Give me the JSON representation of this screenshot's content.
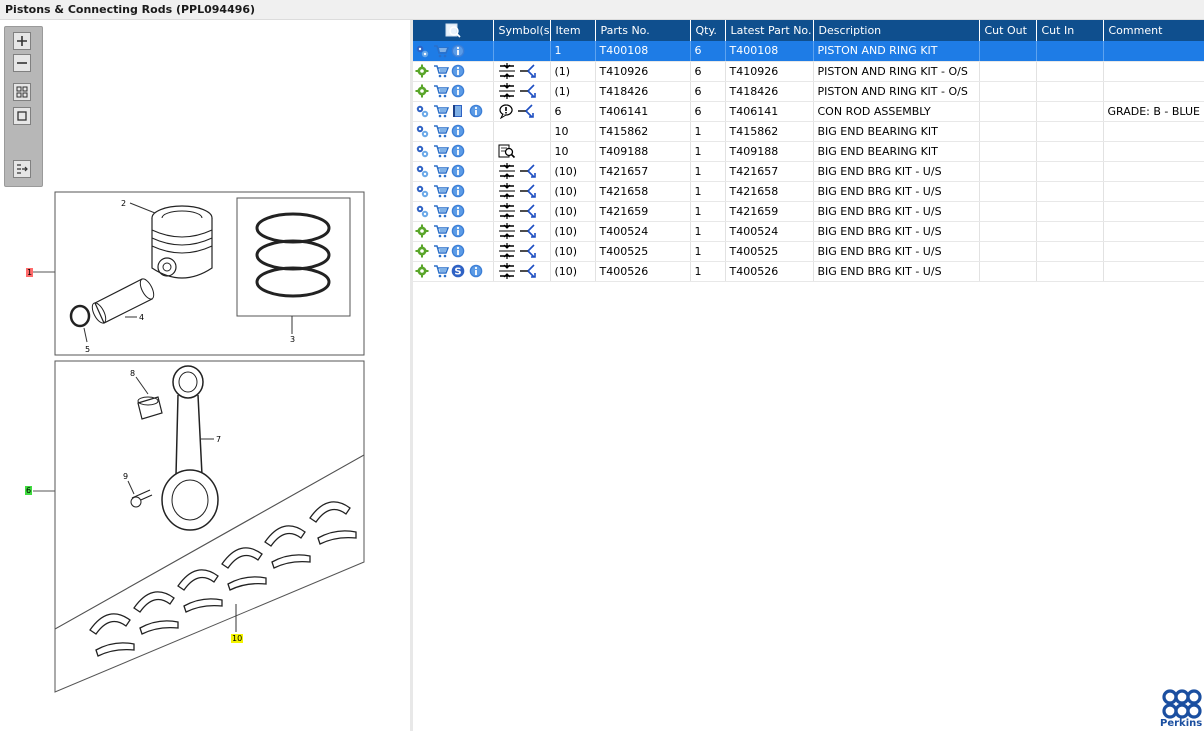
{
  "window": {
    "title": "Pistons & Connecting Rods (PPL094496)"
  },
  "diagram": {
    "callouts": [
      "2",
      "3",
      "4",
      "5",
      "7",
      "8",
      "9"
    ],
    "hotspots": [
      {
        "label": "1",
        "color": "#ff6b6b"
      },
      {
        "label": "6",
        "color": "#3fdc3f"
      },
      {
        "label": "10",
        "color": "#f5f500"
      }
    ]
  },
  "table": {
    "columns": [
      "Symbol(s)",
      "Item",
      "Parts No.",
      "Qty.",
      "Latest Part No.",
      "Description",
      "Cut Out",
      "Cut In",
      "Comment"
    ],
    "rows": [
      {
        "icons": [
          "parts-gear",
          "cart",
          "info"
        ],
        "symbols": [],
        "item": "1",
        "part": "T400108",
        "qty": "6",
        "latest": "T400108",
        "desc": "PISTON AND RING KIT",
        "cutout": "",
        "cutin": "",
        "comment": "",
        "selected": true
      },
      {
        "icons": [
          "gear",
          "cart",
          "info"
        ],
        "symbols": [
          "compress",
          "arrow"
        ],
        "item": "(1)",
        "part": "T410926",
        "qty": "6",
        "latest": "T410926",
        "desc": "PISTON AND RING KIT - O/S",
        "cutout": "",
        "cutin": "",
        "comment": ""
      },
      {
        "icons": [
          "gear",
          "cart",
          "info"
        ],
        "symbols": [
          "compress",
          "arrow"
        ],
        "item": "(1)",
        "part": "T418426",
        "qty": "6",
        "latest": "T418426",
        "desc": "PISTON AND RING KIT - O/S",
        "cutout": "",
        "cutin": "",
        "comment": ""
      },
      {
        "icons": [
          "parts-gear",
          "cart",
          "book",
          "info"
        ],
        "symbols": [
          "comment",
          "arrow"
        ],
        "item": "6",
        "part": "T406141",
        "qty": "6",
        "latest": "T406141",
        "desc": "CON ROD ASSEMBLY",
        "cutout": "",
        "cutin": "",
        "comment": "GRADE: B - BLUE"
      },
      {
        "icons": [
          "parts-gear",
          "cart",
          "info"
        ],
        "symbols": [],
        "item": "10",
        "part": "T415862",
        "qty": "1",
        "latest": "T415862",
        "desc": "BIG END BEARING KIT",
        "cutout": "",
        "cutin": "",
        "comment": ""
      },
      {
        "icons": [
          "parts-gear",
          "cart",
          "info"
        ],
        "symbols": [
          "search-book"
        ],
        "item": "10",
        "part": "T409188",
        "qty": "1",
        "latest": "T409188",
        "desc": "BIG END BEARING KIT",
        "cutout": "",
        "cutin": "",
        "comment": ""
      },
      {
        "icons": [
          "parts-gear",
          "cart",
          "info"
        ],
        "symbols": [
          "compress",
          "arrow"
        ],
        "item": "(10)",
        "part": "T421657",
        "qty": "1",
        "latest": "T421657",
        "desc": "BIG END BRG KIT - U/S",
        "cutout": "",
        "cutin": "",
        "comment": ""
      },
      {
        "icons": [
          "parts-gear",
          "cart",
          "info"
        ],
        "symbols": [
          "compress",
          "arrow"
        ],
        "item": "(10)",
        "part": "T421658",
        "qty": "1",
        "latest": "T421658",
        "desc": "BIG END BRG KIT - U/S",
        "cutout": "",
        "cutin": "",
        "comment": ""
      },
      {
        "icons": [
          "parts-gear",
          "cart",
          "info"
        ],
        "symbols": [
          "compress",
          "arrow"
        ],
        "item": "(10)",
        "part": "T421659",
        "qty": "1",
        "latest": "T421659",
        "desc": "BIG END BRG KIT - U/S",
        "cutout": "",
        "cutin": "",
        "comment": ""
      },
      {
        "icons": [
          "gear",
          "cart",
          "info"
        ],
        "symbols": [
          "compress",
          "arrow"
        ],
        "item": "(10)",
        "part": "T400524",
        "qty": "1",
        "latest": "T400524",
        "desc": "BIG END BRG KIT - U/S",
        "cutout": "",
        "cutin": "",
        "comment": ""
      },
      {
        "icons": [
          "gear",
          "cart",
          "info"
        ],
        "symbols": [
          "compress",
          "arrow"
        ],
        "item": "(10)",
        "part": "T400525",
        "qty": "1",
        "latest": "T400525",
        "desc": "BIG END BRG KIT - U/S",
        "cutout": "",
        "cutin": "",
        "comment": ""
      },
      {
        "icons": [
          "gear",
          "cart",
          "s-badge",
          "info"
        ],
        "symbols": [
          "compress",
          "arrow"
        ],
        "item": "(10)",
        "part": "T400526",
        "qty": "1",
        "latest": "T400526",
        "desc": "BIG END BRG KIT - U/S",
        "cutout": "",
        "cutin": "",
        "comment": ""
      }
    ]
  },
  "brand": {
    "name": "Perkins",
    "color": "#1b4fa0"
  }
}
